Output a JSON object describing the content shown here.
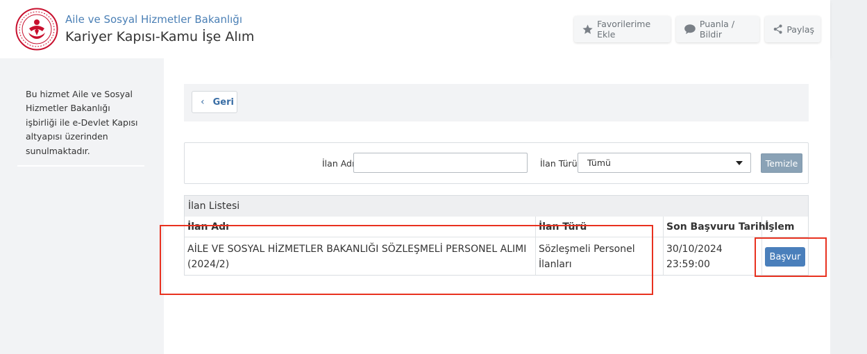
{
  "header": {
    "ministry_name": "Aile ve Sosyal Hizmetler Bakanlığı",
    "service_name": "Kariyer Kapısı-Kamu İşe Alım",
    "actions": {
      "favorite": "Favorilerime Ekle",
      "rate": "Puanla / Bildir",
      "share": "Paylaş"
    }
  },
  "sidebar": {
    "info": "Bu hizmet Aile ve Sosyal Hizmetler Bakanlığı işbirliği ile e-Devlet Kapısı altyapısı üzerinden sunulmaktadır."
  },
  "nav": {
    "back_label": "Geri"
  },
  "filter": {
    "name_label": "İlan Adı",
    "name_value": "",
    "type_label": "İlan Türü",
    "type_selected": "Tümü",
    "clear_label": "Temizle"
  },
  "listing": {
    "title": "İlan Listesi",
    "columns": [
      "İlan Adı",
      "İlan Türü",
      "Son Başvuru Tarihi",
      "İşlem"
    ],
    "rows": [
      {
        "name_line1": "AİLE VE SOSYAL HİZMETLER BAKANLIĞI SÖZLEŞMELİ PERSONEL ALIMI",
        "name_line2": "(2024/2)",
        "type_line1": "Sözleşmeli Personel",
        "type_line2": "İlanları",
        "deadline_date": "30/10/2024",
        "deadline_time": "23:59:00",
        "action": "Başvur"
      }
    ]
  },
  "colors": {
    "brand_red": "#c8102e",
    "link_blue": "#4a7fb5",
    "apply_button": "#4a7fbb",
    "clear_button": "#8aa2b6",
    "annotation_red": "#e8311f"
  },
  "icons": {
    "favorite": "star-icon",
    "rate": "speech-bubble-icon",
    "share": "share-icon",
    "back": "chevron-left-icon",
    "select": "caret-down-icon"
  }
}
